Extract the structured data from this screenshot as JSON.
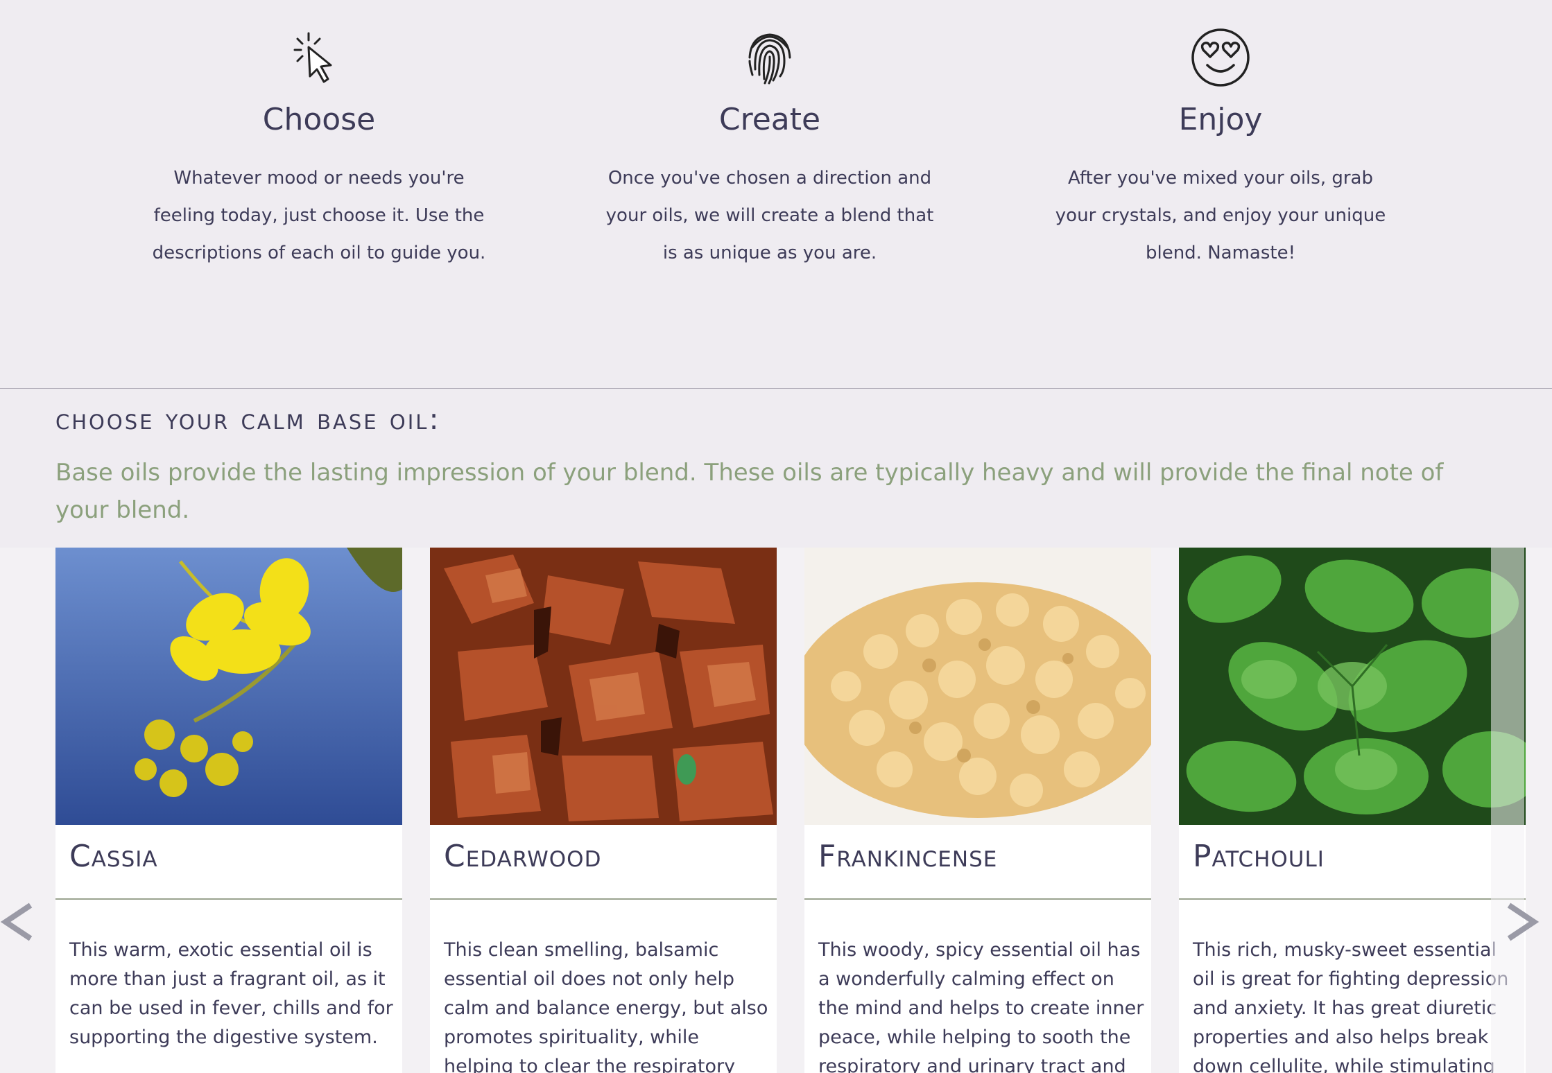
{
  "steps": [
    {
      "icon": "cursor-click-icon",
      "title": "Choose",
      "text": "Whatever mood or needs you're feeling today, just choose it. Use the descriptions of each oil to guide you."
    },
    {
      "icon": "fingerprint-icon",
      "title": "Create",
      "text": "Once you've chosen a direction and your oils, we will create a blend that is as unique as you are."
    },
    {
      "icon": "heart-eyes-emoji-icon",
      "title": "Enjoy",
      "text": "After you've mixed your oils, grab your crystals, and enjoy your unique blend. Namaste!"
    }
  ],
  "section": {
    "title": "choose your calm base oil:",
    "description": "Base oils provide the lasting impression of your blend. These oils are typically heavy and will provide the final note of your blend."
  },
  "oils": [
    {
      "name": "Cassia",
      "description": "This warm, exotic essential oil is more than just a fragrant oil, as it can be used in fever, chills and for supporting the digestive system."
    },
    {
      "name": "Cedarwood",
      "description": "This clean smelling, balsamic essential oil does not only help calm and balance energy, but also promotes spirituality, while helping to clear the respiratory system of"
    },
    {
      "name": "Frankincense",
      "description": "This woody, spicy essential oil has a wonderfully calming effect on the mind and helps to create inner peace, while helping to sooth the respiratory and urinary tract and"
    },
    {
      "name": "Patchouli",
      "description": "This rich, musky-sweet essential oil is great for fighting depression and anxiety. It has great diuretic properties and also helps break down cellulite, while stimulating the"
    }
  ],
  "carousel": {
    "prev_icon": "chevron-left-icon",
    "next_icon": "chevron-right-icon"
  },
  "colors": {
    "text": "#3d3b58",
    "accent_green": "#8ba07c",
    "background": "#efecf1"
  }
}
